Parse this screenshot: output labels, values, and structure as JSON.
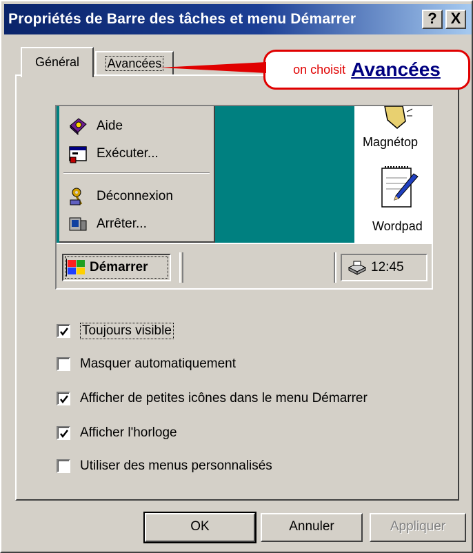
{
  "window": {
    "title": "Propriétés de Barre des tâches et menu Démarrer",
    "help_button": "?",
    "close_button": "X"
  },
  "tabs": [
    {
      "label": "Général",
      "selected": true
    },
    {
      "label": "Avancées",
      "selected": false
    }
  ],
  "callout": {
    "prefix": "on choisit",
    "emphasis": "Avancées"
  },
  "preview": {
    "start_menu_items": [
      {
        "label": "Aide",
        "icon": "help-book-icon"
      },
      {
        "label": "Exécuter...",
        "icon": "run-icon"
      },
      {
        "label": "Déconnexion",
        "icon": "logoff-keys-icon"
      },
      {
        "label": "Arrêter...",
        "icon": "shutdown-icon"
      }
    ],
    "desktop_icons": [
      {
        "label": "Magnétop",
        "icon": "sound-recorder-icon"
      },
      {
        "label": "Wordpad",
        "icon": "wordpad-icon"
      }
    ],
    "start_button": "Démarrer",
    "clock": "12:45"
  },
  "options": [
    {
      "label": "Toujours visible",
      "checked": true
    },
    {
      "label": "Masquer automatiquement",
      "checked": false
    },
    {
      "label": "Afficher de petites icônes dans le menu Démarrer",
      "checked": true
    },
    {
      "label": "Afficher l'horloge",
      "checked": true
    },
    {
      "label": "Utiliser des menus personnalisés",
      "checked": false
    }
  ],
  "buttons": {
    "ok": "OK",
    "cancel": "Annuler",
    "apply": "Appliquer"
  },
  "colors": {
    "title_bar": "#0a246a",
    "dialog_face": "#d4d0c8",
    "desktop": "#008080",
    "callout": "#e00000"
  }
}
